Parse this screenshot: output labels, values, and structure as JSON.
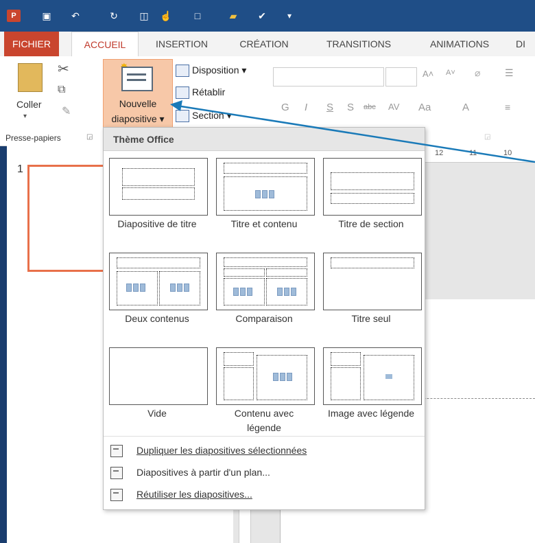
{
  "tabs": [
    "FICHIER",
    "ACCUEIL",
    "INSERTION",
    "CRÉATION",
    "TRANSITIONS",
    "ANIMATIONS",
    "DI"
  ],
  "ribbon": {
    "paste_label": "Coller",
    "clipboard_group": "Presse-papiers",
    "new_slide_line1": "Nouvelle",
    "new_slide_line2": "diapositive",
    "layout": "Disposition",
    "reset": "Rétablir",
    "section": "Section",
    "font_buttons": [
      "G",
      "I",
      "S",
      "S",
      "abc",
      "AV",
      "Aa",
      "A"
    ]
  },
  "slide_pane": {
    "slide_number": "1"
  },
  "ruler": {
    "ticks": [
      "12",
      "11",
      "10"
    ]
  },
  "dropdown": {
    "header": "Thème Office",
    "layouts": [
      {
        "label": "Diapositive de titre"
      },
      {
        "label": "Titre et contenu"
      },
      {
        "label": "Titre de section"
      },
      {
        "label": "Deux contenus"
      },
      {
        "label": "Comparaison"
      },
      {
        "label": "Titre seul"
      },
      {
        "label": "Vide"
      },
      {
        "label": "Contenu avec légende"
      },
      {
        "label": "Image avec légende"
      }
    ],
    "menu": [
      {
        "label": "Dupliquer les diapositives sélectionnées"
      },
      {
        "label": "Diapositives à partir d'un plan..."
      },
      {
        "label": "Réutiliser les diapositives..."
      }
    ]
  },
  "colors": {
    "title_bar": "#1f4e87",
    "file_tab": "#c9452e",
    "accent": "#c0392b",
    "new_slide_highlight": "#f7c8a8",
    "arrow": "#1a7ab8"
  }
}
